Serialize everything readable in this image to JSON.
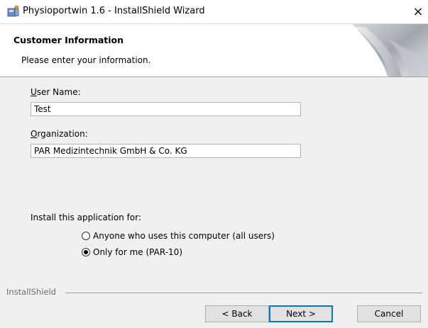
{
  "window": {
    "title": "Physioportwin 1.6 - InstallShield Wizard",
    "close_glyph": "×"
  },
  "header": {
    "title": "Customer Information",
    "subtitle": "Please enter your information."
  },
  "form": {
    "user_name": {
      "label_accel": "U",
      "label_rest": "ser Name:",
      "value": "Test"
    },
    "organization": {
      "label_accel": "O",
      "label_rest": "rganization:",
      "value": "PAR Medizintechnik GmbH & Co. KG"
    },
    "install_for_label": "Install this application for:",
    "options": [
      {
        "label": "Anyone who uses this computer (all users)",
        "selected": false
      },
      {
        "label": "Only for me (PAR-10)",
        "selected": true
      }
    ]
  },
  "footer": {
    "brand": "InstallShield",
    "back_label": "< Back",
    "next_label": "Next >",
    "cancel_label": "Cancel"
  },
  "colors": {
    "accent": "#0078d7",
    "window_bg": "#f0f0f0"
  }
}
